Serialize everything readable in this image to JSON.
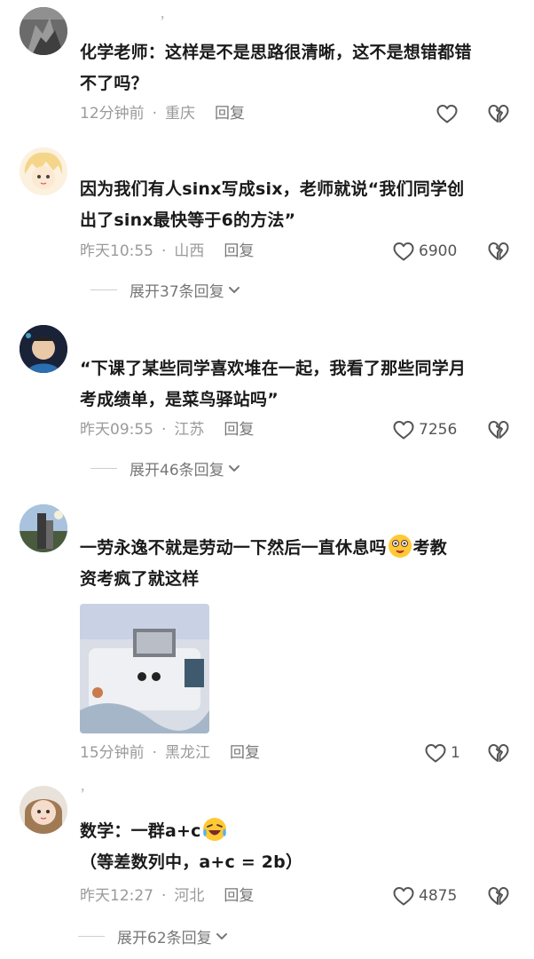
{
  "comments": [
    {
      "username": "，",
      "text_line1": "化学老师：这样是不是思路很清晰，这不是想错都错",
      "text_line2": "不了吗？",
      "time": "12分钟前",
      "location": "重庆",
      "reply": "回复",
      "likes": ""
    },
    {
      "username": "",
      "text_line1": "因为我们有人sinx写成six，老师就说“我们同学创",
      "text_line2": "出了sinx最快等于6的方法”",
      "time": "昨天10:55",
      "location": "山西",
      "reply": "回复",
      "likes": "6900",
      "expand": "展开37条回复"
    },
    {
      "username": "",
      "text_line1": "“下课了某些同学喜欢堆在一起，我看了那些同学月",
      "text_line2": "考成绩单，是菜鸟驿站吗”",
      "time": "昨天09:55",
      "location": "江苏",
      "reply": "回复",
      "likes": "7256",
      "expand": "展开46条回复"
    },
    {
      "username": "",
      "text_line1": "一劳永逸不就是劳动一下然后一直休息吗",
      "text_line1_after": "考教",
      "text_line2": "资考疯了就这样",
      "time": "15分钟前",
      "location": "黑龙江",
      "reply": "回复",
      "likes": "1"
    },
    {
      "username": "，",
      "text_line1": "数学：一群a+c",
      "text_line2": "（等差数列中，a+c = 2b）",
      "time": "昨天12:27",
      "location": "河北",
      "reply": "回复",
      "likes": "4875",
      "expand": "展开62条回复"
    }
  ],
  "meta_separator": "·",
  "icons": {
    "like": "heart-outline-icon",
    "dislike": "broken-heart-icon",
    "expand": "chevron-down-icon"
  },
  "colors": {
    "text": "#1a1a1a",
    "meta": "#9a9a9a",
    "icon": "#555555"
  }
}
